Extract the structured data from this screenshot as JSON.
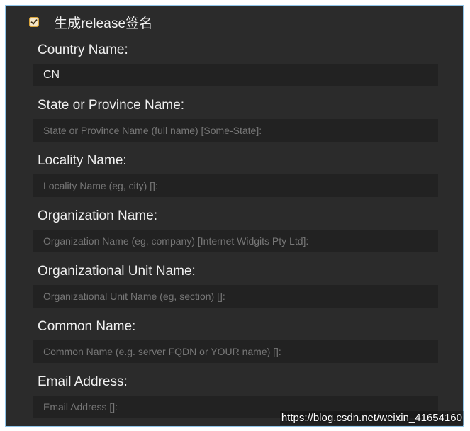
{
  "release_signature": {
    "checked": true,
    "label": "生成release签名"
  },
  "fields": [
    {
      "label": "Country Name:",
      "value": "CN",
      "placeholder": ""
    },
    {
      "label": "State or Province Name:",
      "value": "",
      "placeholder": "State or Province Name (full name) [Some-State]:"
    },
    {
      "label": "Locality Name:",
      "value": "",
      "placeholder": "Locality Name (eg, city) []:"
    },
    {
      "label": "Organization Name:",
      "value": "",
      "placeholder": "Organization Name (eg, company) [Internet Widgits Pty Ltd]:"
    },
    {
      "label": "Organizational Unit Name:",
      "value": "",
      "placeholder": "Organizational Unit Name (eg, section) []:"
    },
    {
      "label": "Common Name:",
      "value": "",
      "placeholder": "Common Name (e.g. server FQDN or YOUR name) []:"
    },
    {
      "label": "Email Address:",
      "value": "",
      "placeholder": "Email Address []:"
    }
  ],
  "watermark": "https://blog.csdn.net/weixin_41654160",
  "colors": {
    "background": "#2b2b2b",
    "input_background": "#222222",
    "checkbox_accent": "#d9a43a",
    "frame_border": "#8fc4e8"
  }
}
